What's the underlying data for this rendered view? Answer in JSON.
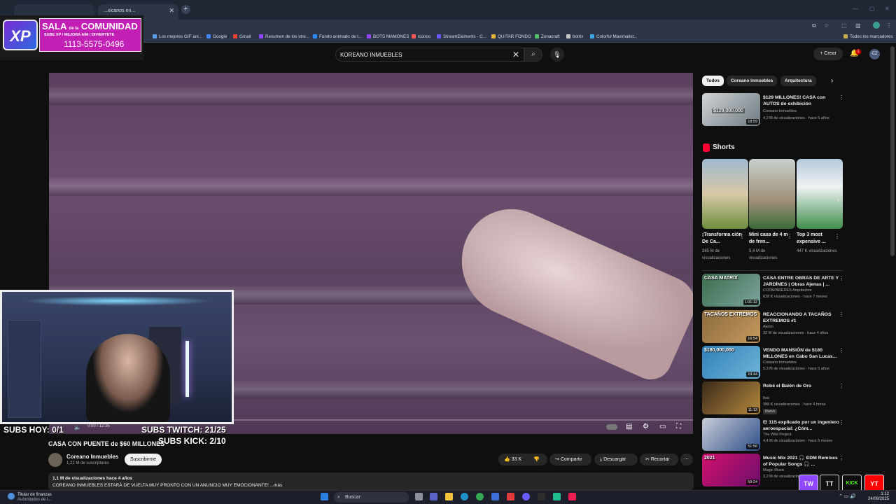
{
  "browser": {
    "active_tab": "...xicanos en...",
    "bookmarks": [
      {
        "label": "Los mejores GIF ani...",
        "color": "#5aa0e8"
      },
      {
        "label": "Google",
        "color": "#4285f4"
      },
      {
        "label": "Gmail",
        "color": "#ea4335"
      },
      {
        "label": "Resumen de los stre...",
        "color": "#9147ff"
      },
      {
        "label": "Fondo animado de l...",
        "color": "#2e8bff"
      },
      {
        "label": "BOTS MAMONES",
        "color": "#9147ff"
      },
      {
        "label": "iconos",
        "color": "#ff5a5a"
      },
      {
        "label": "StreamElements - C...",
        "color": "#6a5cff"
      },
      {
        "label": "QUITAR FONDO",
        "color": "#e2b23f"
      },
      {
        "label": "Zonacraft",
        "color": "#53c26b"
      },
      {
        "label": "botrix",
        "color": "#c9c9c9"
      },
      {
        "label": "Colorful Maximalist...",
        "color": "#3fa7e6"
      }
    ],
    "all_bookmarks": "Todos los marcadores"
  },
  "banner": {
    "logo": "XP",
    "line1_big": "SALA",
    "line1_small": "de la",
    "line1_end": "COMUNIDAD",
    "line2": "SUBE XP / MEJORA AIM / DIVIERTETE",
    "line3": "1113-5575-0496"
  },
  "header": {
    "search_value": "KOREANO INMUEBLES",
    "create_label": "Crear",
    "notif_count": "1",
    "avatar": "CZ"
  },
  "video": {
    "time": "0:00 / 12:35",
    "title": "CASA CON PUENTE de $60 MILLONES",
    "channel": "Coreano Inmuebles",
    "subs": "1,22 M de suscriptores",
    "subscribe": "Suscribirme",
    "likes": "33 K",
    "share": "Compartir",
    "download": "Descargar",
    "clip": "Recortar",
    "views_date": "1,1 M de visualizaciones  hace 4 años",
    "description": "COREANO INMUEBLES ESTARÁ DE VUELTA MUY PRONTO CON UN ANUNCIO MUY EMOCIONANTE! ...más"
  },
  "overlay": {
    "subs_hoy": "SUBS HOY: 0/1",
    "subs_twitch": "SUBS TWITCH:  21/25",
    "subs_kick": "SUBS KICK:     2/10"
  },
  "sidebar": {
    "chips": [
      "Todos",
      "Coreano Inmuebles",
      "Arquitectura"
    ],
    "top_rec": {
      "title": "$129 MILLONES! CASA con AUTOS de exhibición",
      "channel": "Coreano Inmuebles",
      "meta": "4,2 M de visualizaciones · hace 5 años",
      "duration": "18:59",
      "thumb_text": "$129,000,000"
    },
    "shorts_label": "Shorts",
    "shorts": [
      {
        "title": "¡Transforma ción De Ca...",
        "meta": "385 M de visualizaciones"
      },
      {
        "title": "Mini casa de 4 m de fren...",
        "meta": "5,4 M de visualizaciones"
      },
      {
        "title": "Top 3 most expensive ...",
        "meta": "447 K visualizaciones"
      }
    ],
    "recs": [
      {
        "title": "CASA ENTRE OBRAS DE ARTE Y JARDÍNES | Obras Ajenas | ...",
        "channel": "COTAPAREDES Arquitectos",
        "meta": "628 K visualizaciones · hace 7 meses",
        "duration": "1:01:12",
        "thumb_text": "CASA MATRIX",
        "colors": [
          "#3b6b4a",
          "#7da6a0"
        ]
      },
      {
        "title": "REACCIONANDO A TACAÑOS EXTREMOS #1",
        "channel": "Aaron",
        "meta": "32 M de visualizaciones · hace 4 años",
        "duration": "16:54",
        "thumb_text": "TACAÑOS EXTREMOS",
        "colors": [
          "#8a6a3d",
          "#c59a5e"
        ]
      },
      {
        "title": "VENDO MANSIÓN de $180 MILLONES en Cabo San Lucas...",
        "channel": "Coreano Inmuebles",
        "meta": "5,3 M de visualizaciones · hace 5 años",
        "duration": "19:44",
        "thumb_text": "$180,000,000",
        "colors": [
          "#2e7fb8",
          "#6fb5d9"
        ]
      },
      {
        "title": "Robé el Balón de Oro",
        "channel": "Ibai",
        "meta": "388 K visualizaciones · hace 4 horas",
        "duration": "11:13",
        "badge": "Nuevo",
        "thumb_text": "",
        "colors": [
          "#3b2a1a",
          "#b5893e"
        ]
      },
      {
        "title": "El 11S explicado por un ingeniero aeroespacial: ¿Cóm...",
        "channel": "The Wild Project",
        "meta": "4,4 M de visualizaciones · hace 6 meses",
        "duration": "51:56",
        "thumb_text": "",
        "colors": [
          "#c8ccd8",
          "#2f4f8a"
        ]
      },
      {
        "title": "Music Mix 2021 🎧 EDM Remixes of Popular Songs 🎧 ...",
        "channel": "Magic Music",
        "meta": "3,2 M de visualizaciones",
        "duration": "59:24",
        "thumb_text": "2021",
        "colors": [
          "#d4106d",
          "#6a0f6a"
        ]
      }
    ]
  },
  "social": [
    "TW",
    "TT",
    "KICK",
    "YT"
  ],
  "taskbar": {
    "weather_title": "Titular de finanzas",
    "weather_sub": "Autoridades de I...",
    "search": "Buscar",
    "time": "1:12",
    "date": "24/09/2025"
  }
}
